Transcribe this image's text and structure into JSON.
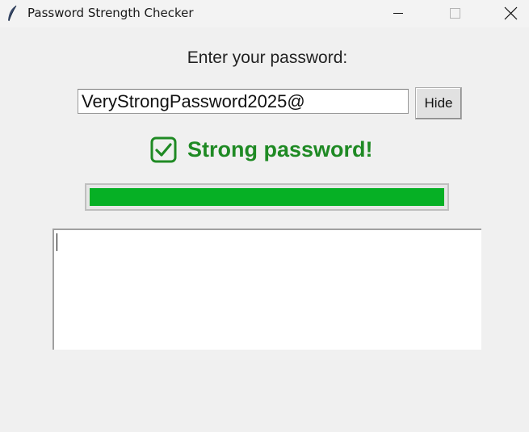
{
  "window": {
    "title": "Password Strength Checker",
    "icon": "feather-icon",
    "controls": [
      "minimize-icon",
      "maximize-icon",
      "close-icon"
    ]
  },
  "form": {
    "prompt": "Enter your password:",
    "password_value": "VeryStrongPassword2025@",
    "toggle_label": "Hide"
  },
  "status": {
    "icon": "check-box-icon",
    "text": "Strong password!",
    "color": "#1f8a24"
  },
  "strength": {
    "percent": 100,
    "color": "#06b025"
  },
  "feedback": {
    "text": ""
  }
}
